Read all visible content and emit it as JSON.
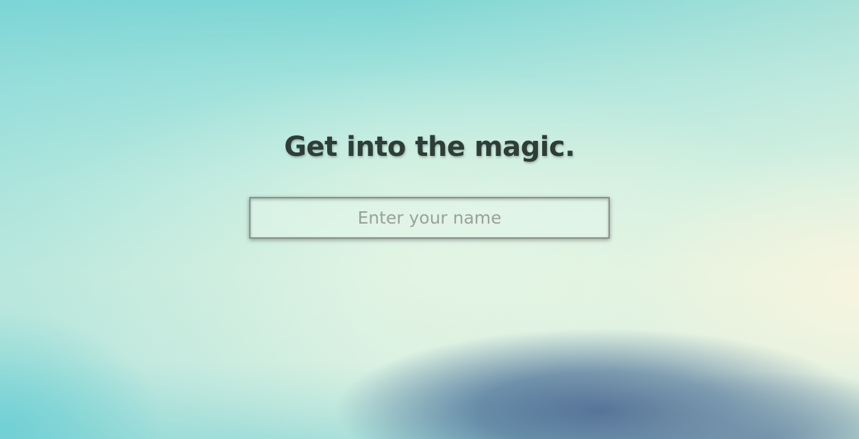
{
  "page": {
    "headline": "Get into the magic."
  },
  "form": {
    "name_placeholder": "Enter your name",
    "name_value": ""
  },
  "colors": {
    "headline_text": "#2e3d38",
    "input_border": "#8a8f8c",
    "placeholder_text": "#9a9f9c",
    "background_top": "#7fd6d5",
    "background_hill": "#325587"
  }
}
